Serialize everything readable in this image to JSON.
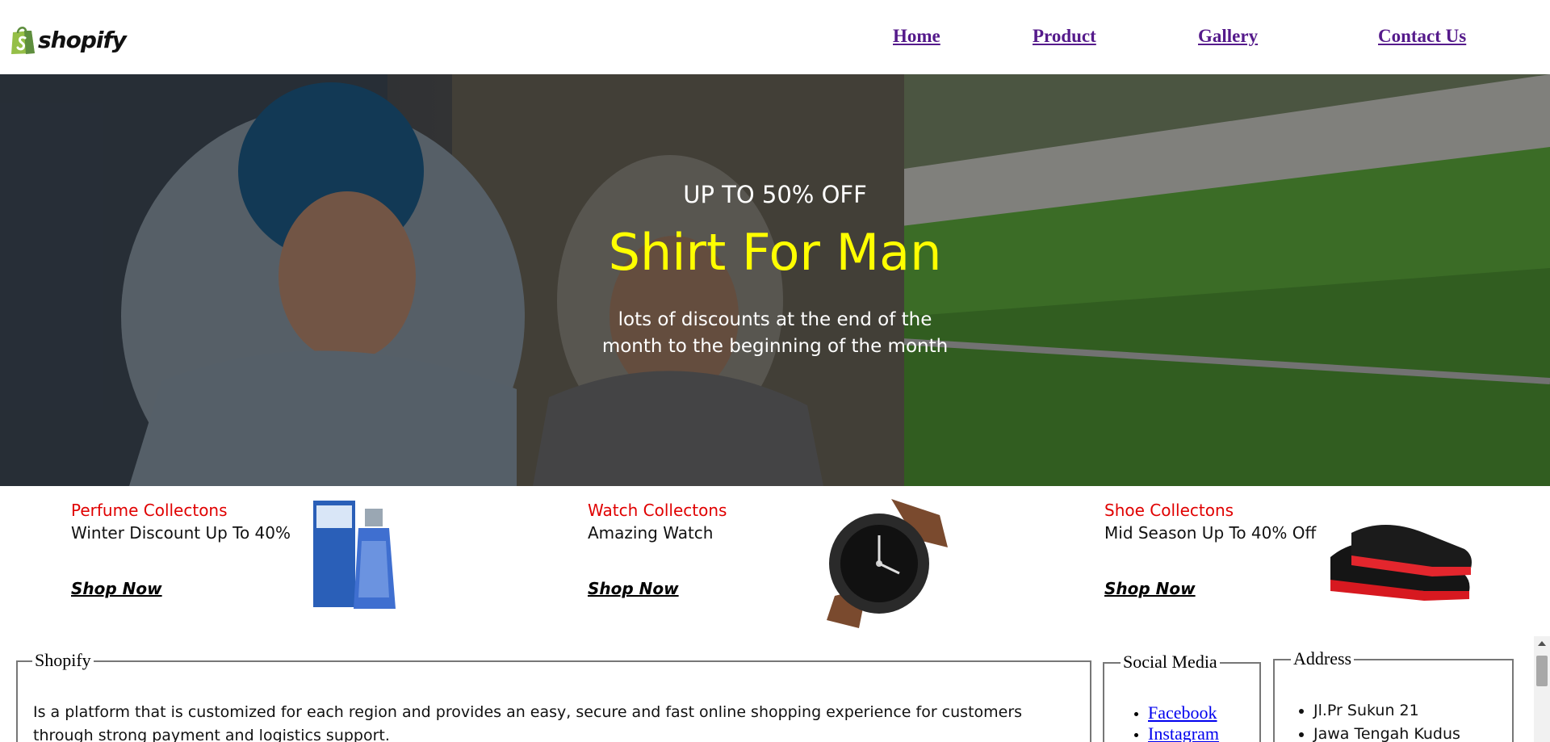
{
  "header": {
    "brand": "shopify",
    "nav": [
      "Home",
      "Product",
      "Gallery",
      "Contact Us"
    ]
  },
  "hero": {
    "promo": "UP TO 50% OFF",
    "title": "Shirt For Man",
    "desc_line1": "lots of discounts at the end of the",
    "desc_line2": "month to the beginning of the month"
  },
  "collections": [
    {
      "category": "Perfume Collectons",
      "desc": "Winter Discount Up To 40%",
      "cta": "Shop Now",
      "image": "perfume-bottle-image"
    },
    {
      "category": "Watch Collectons",
      "desc": "Amazing Watch",
      "cta": "Shop Now",
      "image": "wrist-watch-image"
    },
    {
      "category": "Shoe Collectons",
      "desc": "Mid Season Up To 40% Off",
      "cta": "Shop Now",
      "image": "shoe-image"
    }
  ],
  "footer": {
    "about": {
      "legend": "Shopify",
      "text": "Is a platform that is customized for each region and provides an easy, secure and fast online shopping experience for customers through strong payment and logistics support."
    },
    "social": {
      "legend": "Social Media",
      "links": [
        "Facebook",
        "Instagram"
      ]
    },
    "address": {
      "legend": "Address",
      "lines": [
        "Jl.Pr Sukun 21",
        "Jawa Tengah Kudus"
      ]
    }
  },
  "colors": {
    "hero_title": "#ffff00",
    "collection_category": "#e00000",
    "nav_link": "#551a8b",
    "social_link": "#0000ee",
    "logo_green": "#95bf47"
  }
}
